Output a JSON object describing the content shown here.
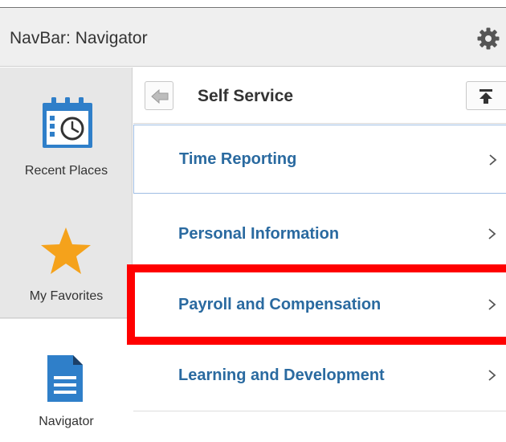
{
  "header": {
    "title": "NavBar: Navigator"
  },
  "rail": {
    "items": [
      {
        "label": "Recent Places"
      },
      {
        "label": "My Favorites"
      },
      {
        "label": "Navigator"
      }
    ]
  },
  "content": {
    "title": "Self Service",
    "menu": [
      {
        "label": "Time Reporting"
      },
      {
        "label": "Personal Information"
      },
      {
        "label": "Payroll and Compensation"
      },
      {
        "label": "Learning and Development"
      }
    ]
  },
  "colors": {
    "link": "#2a6aa0",
    "accent_orange": "#f5a21b",
    "navigator_blue": "#2f7fc9",
    "highlight_red": "#ff0000"
  },
  "icons": {
    "settings": "gear-icon",
    "back": "back-arrow-icon",
    "top": "scroll-to-top-icon",
    "recent": "calendar-clock-icon",
    "favorites": "star-icon",
    "navigator": "document-icon",
    "chevron": "chevron-right-icon"
  }
}
